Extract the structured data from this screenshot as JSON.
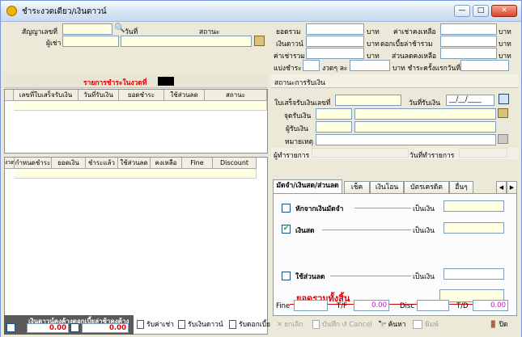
{
  "window": {
    "title": "ชำระงวดเดียว/เงินดาวน์",
    "buttons": {
      "minimize": "—",
      "maximize": "□",
      "close": "✕"
    }
  },
  "contract": {
    "contract_no_label": "สัญญาเลขที่",
    "date_label": "วันที่",
    "status_label": "สถานะ",
    "renter_label": "ผู้เช่า"
  },
  "summary": {
    "total_label": "ยอดรวม",
    "down_label": "เงินดาวน์",
    "rent_total_label": "ค่าเช่ารวม",
    "installment_label": "แบ่งชำระ",
    "period_unit": "งวดๆ ละ",
    "baht": "บาท",
    "rent_remain_label": "ค่าเช่าคงเหลือ",
    "interest_total_label": "ดอกเบี้ยล่าช้ารวม",
    "discount_remain_label": "ส่วนลดคงเหลือ",
    "first_pay_label": "บาท ชำระครั้งแรกวันที่"
  },
  "period_section": {
    "title": "รายการชำระในงวดที่",
    "columns": [
      "เลขที่ใบเสร็จรับเงิน",
      "วันที่รับเงิน",
      "ยอดชำระ",
      "ใช้ส่วนลด",
      "สถานะ"
    ]
  },
  "schedule_grid": {
    "columns": [
      "งวด",
      "กำหนดชำระ",
      "ยอดเงิน",
      "ชำระแล้ว",
      "ใช้ส่วนลด",
      "คงเหลือ",
      "Fine",
      "Discount"
    ]
  },
  "receipt": {
    "status_header": "สถานะการรับเงิน",
    "receipt_no_label": "ใบเสร็จรับเงินเลขที่",
    "receive_date_label": "วันที่รับเงิน",
    "receive_date_value": "__/__/____",
    "place_label": "จุดรับเงิน",
    "receiver_label": "ผู้รับเงิน",
    "note_label": "หมายเหตุ",
    "operator_label": "ผู้ทำรายการ",
    "op_date_label": "วันที่ทำรายการ"
  },
  "tabs": [
    "มัดจำ/เงินสด/ส่วนลด",
    "เช็ค",
    "เงินโอน",
    "บัตรเครดิต",
    "อื่นๆ"
  ],
  "payment": {
    "deposit_label": "หักจากเงินมัดจำ",
    "cash_label": "เงินสด",
    "discount_label": "ใช้ส่วนลด",
    "amount_label": "เป็นเงิน",
    "grand_total_label": "ยอดรวมทั้งสิ้น",
    "cash_checked": true
  },
  "bottom_fields": {
    "fine_label": "Fine",
    "tf_label": "T/F",
    "tf_value": "0.00",
    "disc_label": "Disc",
    "td_label": "T/D",
    "td_value": "0.00"
  },
  "footer_left": {
    "caption": "เงินดาวน์คงค้างดอกเบี้ยล่าช้าคงค้าง",
    "down_value": "0.00",
    "interest_value": "0.00"
  },
  "actions": {
    "receive_rent": "รับค่าเช่า",
    "receive_down": "รับเงินดาวน์",
    "receive_interest": "รับดอกเบี้ย",
    "cancel_th": "ยกเลิก",
    "save": "บันทึก",
    "cancel_en": "Cancel",
    "search": "ค้นหา",
    "print": "พิมพ์",
    "close": "ปิด"
  },
  "colors": {
    "accent_red": "#e00000",
    "field_yellow": "#ffffe1",
    "magenta_value": "#e000e0"
  }
}
